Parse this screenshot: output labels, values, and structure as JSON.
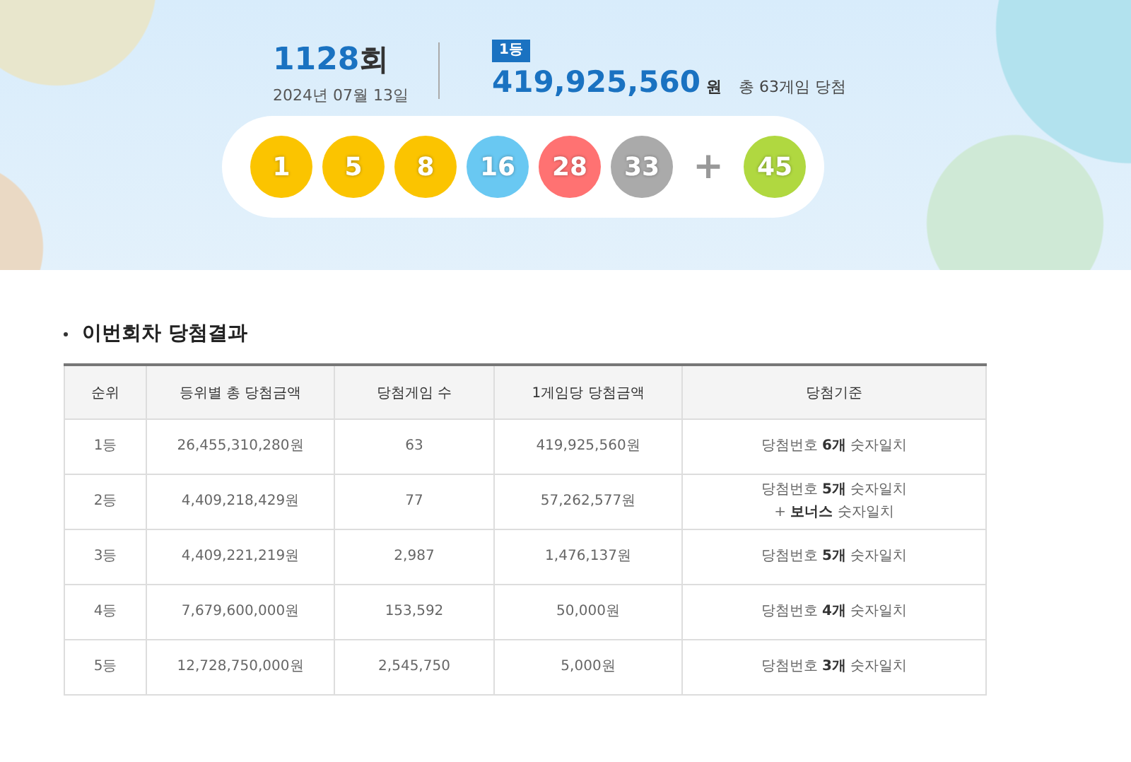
{
  "draw": {
    "round": "1128",
    "round_suffix": "회",
    "date": "2024년 07월 13일",
    "rank_badge": "1등",
    "first_prize": "419,925,560",
    "first_prize_unit": "원",
    "winners_text": "총 63게임 당첨"
  },
  "balls": [
    {
      "number": "1",
      "color": "#fbc400"
    },
    {
      "number": "5",
      "color": "#fbc400"
    },
    {
      "number": "8",
      "color": "#fbc400"
    },
    {
      "number": "16",
      "color": "#69c8f2"
    },
    {
      "number": "28",
      "color": "#ff7272"
    },
    {
      "number": "33",
      "color": "#aaaaaa"
    }
  ],
  "plus": "+",
  "bonus": {
    "number": "45",
    "color": "#b0d840"
  },
  "section_title": "이번회차 당첨결과",
  "table": {
    "columns": [
      "순위",
      "등위별 총 당첨금액",
      "당첨게임 수",
      "1게임당 당첨금액",
      "당첨기준"
    ],
    "rows": [
      {
        "rank": "1등",
        "total": "26,455,310,280원",
        "games": "63",
        "per_game": "419,925,560원",
        "criteria": [
          "당첨번호 **6개** 숫자일치"
        ]
      },
      {
        "rank": "2등",
        "total": "4,409,218,429원",
        "games": "77",
        "per_game": "57,262,577원",
        "criteria": [
          "당첨번호 **5개** 숫자일치",
          "+ **보너스** 숫자일치"
        ]
      },
      {
        "rank": "3등",
        "total": "4,409,221,219원",
        "games": "2,987",
        "per_game": "1,476,137원",
        "criteria": [
          "당첨번호 **5개** 숫자일치"
        ]
      },
      {
        "rank": "4등",
        "total": "7,679,600,000원",
        "games": "153,592",
        "per_game": "50,000원",
        "criteria": [
          "당첨번호 **4개** 숫자일치"
        ]
      },
      {
        "rank": "5등",
        "total": "12,728,750,000원",
        "games": "2,545,750",
        "per_game": "5,000원",
        "criteria": [
          "당첨번호 **3개** 숫자일치"
        ]
      }
    ]
  }
}
